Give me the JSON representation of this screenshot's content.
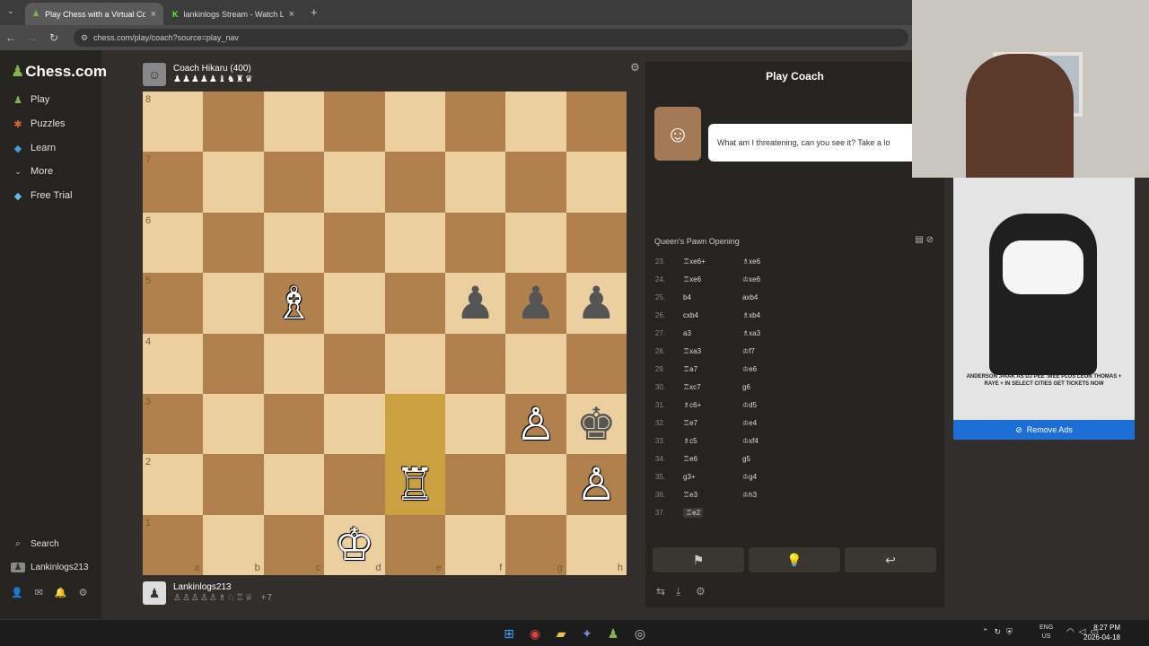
{
  "browser": {
    "tabs": [
      {
        "title": "Play Chess with a Virtual Coach",
        "active": true
      },
      {
        "title": "lankinlogs Stream - Watch Live",
        "active": false
      }
    ],
    "url": "chess.com/play/coach?source=play_nav"
  },
  "sidebar": {
    "logo": "Chess.com",
    "items": [
      {
        "label": "Play",
        "icon": "play-icon"
      },
      {
        "label": "Puzzles",
        "icon": "puzzle-icon"
      },
      {
        "label": "Learn",
        "icon": "learn-icon"
      },
      {
        "label": "More",
        "icon": "chevron-down-icon"
      },
      {
        "label": "Free Trial",
        "icon": "diamond-icon"
      }
    ],
    "search_label": "Search",
    "username": "Lankinlogs213"
  },
  "top_player": {
    "name": "Coach Hikaru (400)",
    "captured": "♟♟♟♟♟♝♞♜♛"
  },
  "bottom_player": {
    "name": "Lankinlogs213",
    "captured": "♙♙♙♙♙♗♘♖♕",
    "advantage": "+7"
  },
  "board": {
    "ranks": [
      "8",
      "7",
      "6",
      "5",
      "4",
      "3",
      "2",
      "1"
    ],
    "files": [
      "a",
      "b",
      "c",
      "d",
      "e",
      "f",
      "g",
      "h"
    ],
    "highlight_squares": [
      "e3",
      "e2"
    ],
    "pieces": {
      "c5": "♗",
      "f5": "♟",
      "g5": "♟",
      "h5": "♟",
      "g3": "♙",
      "h3": "♚",
      "e2": "♖",
      "h2": "♙",
      "d1": "♔"
    },
    "white_squares": [
      "c5",
      "g3",
      "e2",
      "h2",
      "d1"
    ]
  },
  "panel": {
    "title": "Play Coach",
    "coach_message": "What am I threatening, can you see it? Take a lo",
    "opening": "Queen's Pawn Opening",
    "moves": [
      {
        "num": "23.",
        "white": "♖xe6+",
        "black": "♗xe6"
      },
      {
        "num": "24.",
        "white": "♖xe6",
        "black": "♔xe6"
      },
      {
        "num": "25.",
        "white": "b4",
        "black": "axb4"
      },
      {
        "num": "26.",
        "white": "cxb4",
        "black": "♗xb4"
      },
      {
        "num": "27.",
        "white": "a3",
        "black": "♗xa3"
      },
      {
        "num": "28.",
        "white": "♖xa3",
        "black": "♔f7"
      },
      {
        "num": "29.",
        "white": "♖a7",
        "black": "♔e6"
      },
      {
        "num": "30.",
        "white": "♖xc7",
        "black": "g6"
      },
      {
        "num": "31.",
        "white": "♗c6+",
        "black": "♔d5"
      },
      {
        "num": "32.",
        "white": "♖e7",
        "black": "♔e4"
      },
      {
        "num": "33.",
        "white": "♗c5",
        "black": "♔xf4"
      },
      {
        "num": "34.",
        "white": "♖e6",
        "black": "g5"
      },
      {
        "num": "35.",
        "white": "g3+",
        "black": "♔g4"
      },
      {
        "num": "36.",
        "white": "♖e3",
        "black": "♔h3"
      },
      {
        "num": "37.",
        "white": "♖e2",
        "black": ""
      }
    ],
    "buttons": {
      "resign": "⚑",
      "hint": "💡",
      "undo": "↩"
    }
  },
  "ad": {
    "text": "ANDERSON .PAAK AS DJ PEE .WEE PLUS LEON THOMAS + RAYE + IN SELECT CITIES GET TICKETS NOW",
    "remove_label": "Remove Ads"
  },
  "taskbar": {
    "lang_top": "ENG",
    "lang_bottom": "US",
    "time": "8:27 PM",
    "date": "2026-04-18"
  }
}
